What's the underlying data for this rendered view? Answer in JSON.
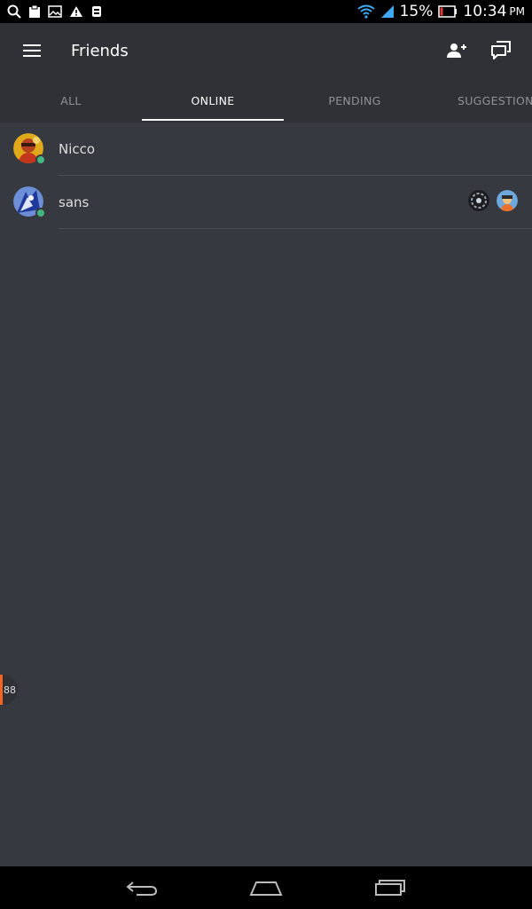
{
  "status_bar": {
    "battery": "15%",
    "time": "10:34",
    "ampm": "PM"
  },
  "app_bar": {
    "title": "Friends",
    "icons": [
      "menu-icon",
      "add-friend-icon",
      "new-group-dm-icon"
    ]
  },
  "tabs": [
    {
      "label": "ALL",
      "active": false
    },
    {
      "label": "ONLINE",
      "active": true
    },
    {
      "label": "PENDING",
      "active": false
    },
    {
      "label": "SUGGESTIONS",
      "active": false
    }
  ],
  "friends": [
    {
      "name": "Nicco",
      "status": "online"
    },
    {
      "name": "sans",
      "status": "online"
    }
  ],
  "side_badge": {
    "count": "88"
  },
  "colors": {
    "background": "#36393f",
    "header": "#2f3136",
    "online": "#43b581",
    "accent": "#f26522"
  }
}
